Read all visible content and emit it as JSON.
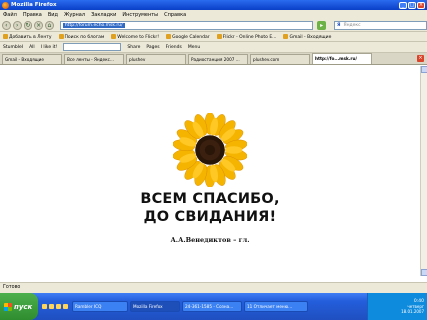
{
  "window": {
    "title": "Mozilla Firefox"
  },
  "menu": [
    "Файл",
    "Правка",
    "Вид",
    "Журнал",
    "Закладки",
    "Инструменты",
    "Справка"
  ],
  "nav": {
    "url": "http://forum.echo.msk.ru/",
    "search_placeholder": "Яндекс"
  },
  "bookmarks": [
    "Добавить в Ленту",
    "Поиск по блогам",
    "Welcome to Flickr!",
    "Google Calendar",
    "Flickr - Online Photo E...",
    "Gmail - Входящие"
  ],
  "toolbar": [
    "StumbleI",
    "All",
    "I like it!",
    "Share",
    "Pages",
    "Friends",
    "Menu"
  ],
  "tabs": [
    "Gmail - Входящие",
    "Все ленты - Яндекс...",
    "plushev",
    "Радиостанция 2007 ...",
    "plushev.com",
    "http://fo...msk.ru/"
  ],
  "content": {
    "line1": "ВСЕМ СПАСИБО,",
    "line2": "ДО СВИДАНИЯ!",
    "author": "А.А.Венедиктов – гл."
  },
  "status": "Готово",
  "taskbar": {
    "start": "пуск",
    "row1": [
      "Rambler ICQ",
      "Mozilla Firefox",
      "24-361-1585 - Созна...",
      "11 Отличает меню..."
    ],
    "time": "0:40",
    "day": "четверг",
    "date": "18.01.2007"
  }
}
